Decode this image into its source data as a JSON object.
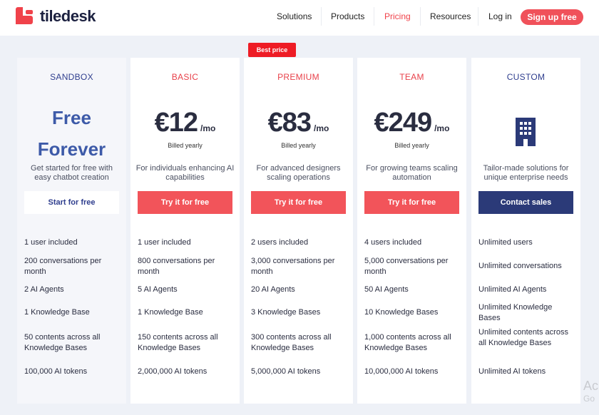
{
  "brand": {
    "name": "tiledesk"
  },
  "nav": {
    "items": [
      {
        "label": "Solutions",
        "active": false
      },
      {
        "label": "Products",
        "active": false
      },
      {
        "label": "Pricing",
        "active": true
      },
      {
        "label": "Resources",
        "active": false
      },
      {
        "label": "Log in",
        "active": false
      }
    ],
    "signup_label": "Sign up free"
  },
  "badge": "Best price",
  "plans": [
    {
      "name": "SANDBOX",
      "free_line1": "Free",
      "free_line2": "Forever",
      "description": "Get started for free with easy chatbot creation",
      "cta": "Start for free",
      "features": [
        "1 user included",
        "200 conversations per month",
        "2 AI Agents",
        "1 Knowledge Base",
        "50 contents across all Knowledge Bases",
        "100,000 AI tokens"
      ]
    },
    {
      "name": "BASIC",
      "price": "€12",
      "per": "/mo",
      "billed": "Billed yearly",
      "description": "For individuals enhancing AI capabilities",
      "cta": "Try it for free",
      "features": [
        "1 user included",
        "800 conversations per month",
        "5 AI Agents",
        "1 Knowledge Base",
        "150 contents across all Knowledge Bases",
        "2,000,000 AI tokens"
      ]
    },
    {
      "name": "PREMIUM",
      "price": "€83",
      "per": "/mo",
      "billed": "Billed yearly",
      "description": "For advanced designers scaling operations",
      "cta": "Try it for free",
      "features": [
        "2 users included",
        "3,000 conversations per month",
        "20 AI Agents",
        "3 Knowledge Bases",
        "300 contents across all Knowledge Bases",
        "5,000,000 AI tokens"
      ]
    },
    {
      "name": "TEAM",
      "price": "€249",
      "per": "/mo",
      "billed": "Billed yearly",
      "description": "For growing teams scaling automation",
      "cta": "Try it for free",
      "features": [
        "4 users included",
        "5,000 conversations per month",
        "50 AI Agents",
        "10 Knowledge Bases",
        "1,000 contents across all Knowledge Bases",
        "10,000,000 AI tokens"
      ]
    },
    {
      "name": "CUSTOM",
      "icon": "building-icon",
      "description": "Tailor-made solutions for unique enterprise needs",
      "cta": "Contact sales",
      "features": [
        "Unlimited users",
        "Unlimited conversations",
        "Unlimited AI Agents",
        "Unlimited Knowledge Bases",
        "Unlimited contents across all Knowledge Bases",
        "Unlimited AI tokens"
      ]
    }
  ],
  "watermark": {
    "line1": "Ac",
    "line2": "Go"
  },
  "colors": {
    "accent": "#f0424a",
    "navy": "#2b3a78",
    "free_blue": "#3d5aa8"
  }
}
